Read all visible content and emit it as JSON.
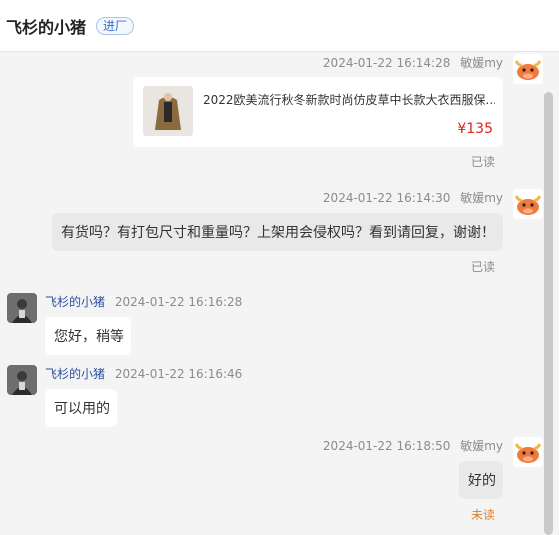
{
  "header": {
    "title": "飞杉的小猪",
    "badge": "进厂"
  },
  "messages": [
    {
      "sender": "敏媛my",
      "time": "2024-01-22 16:14:28",
      "product": {
        "title": "2022欧美流行秋冬新款时尚仿皮草中长款大衣西服保...",
        "price": "¥135"
      },
      "status": "已读"
    },
    {
      "sender": "敏媛my",
      "time": "2024-01-22 16:14:30",
      "text": "有货吗？有打包尺寸和重量吗？上架用会侵权吗？看到请回复，谢谢！",
      "status": "已读"
    },
    {
      "sender": "飞杉的小猪",
      "time": "2024-01-22 16:16:28",
      "text": "您好，稍等"
    },
    {
      "sender": "飞杉的小猪",
      "time": "2024-01-22 16:16:46",
      "text": "可以用的"
    },
    {
      "sender": "敏媛my",
      "time": "2024-01-22 16:18:50",
      "text": "好的",
      "status": "未读"
    }
  ],
  "icons": {
    "self_avatar": "cartoon-cow-avatar-icon",
    "other_avatar": "dark-photo-avatar-icon"
  },
  "colors": {
    "price": "#d8261e",
    "unread": "#d9822b",
    "peer_name": "#2d4fa1"
  }
}
